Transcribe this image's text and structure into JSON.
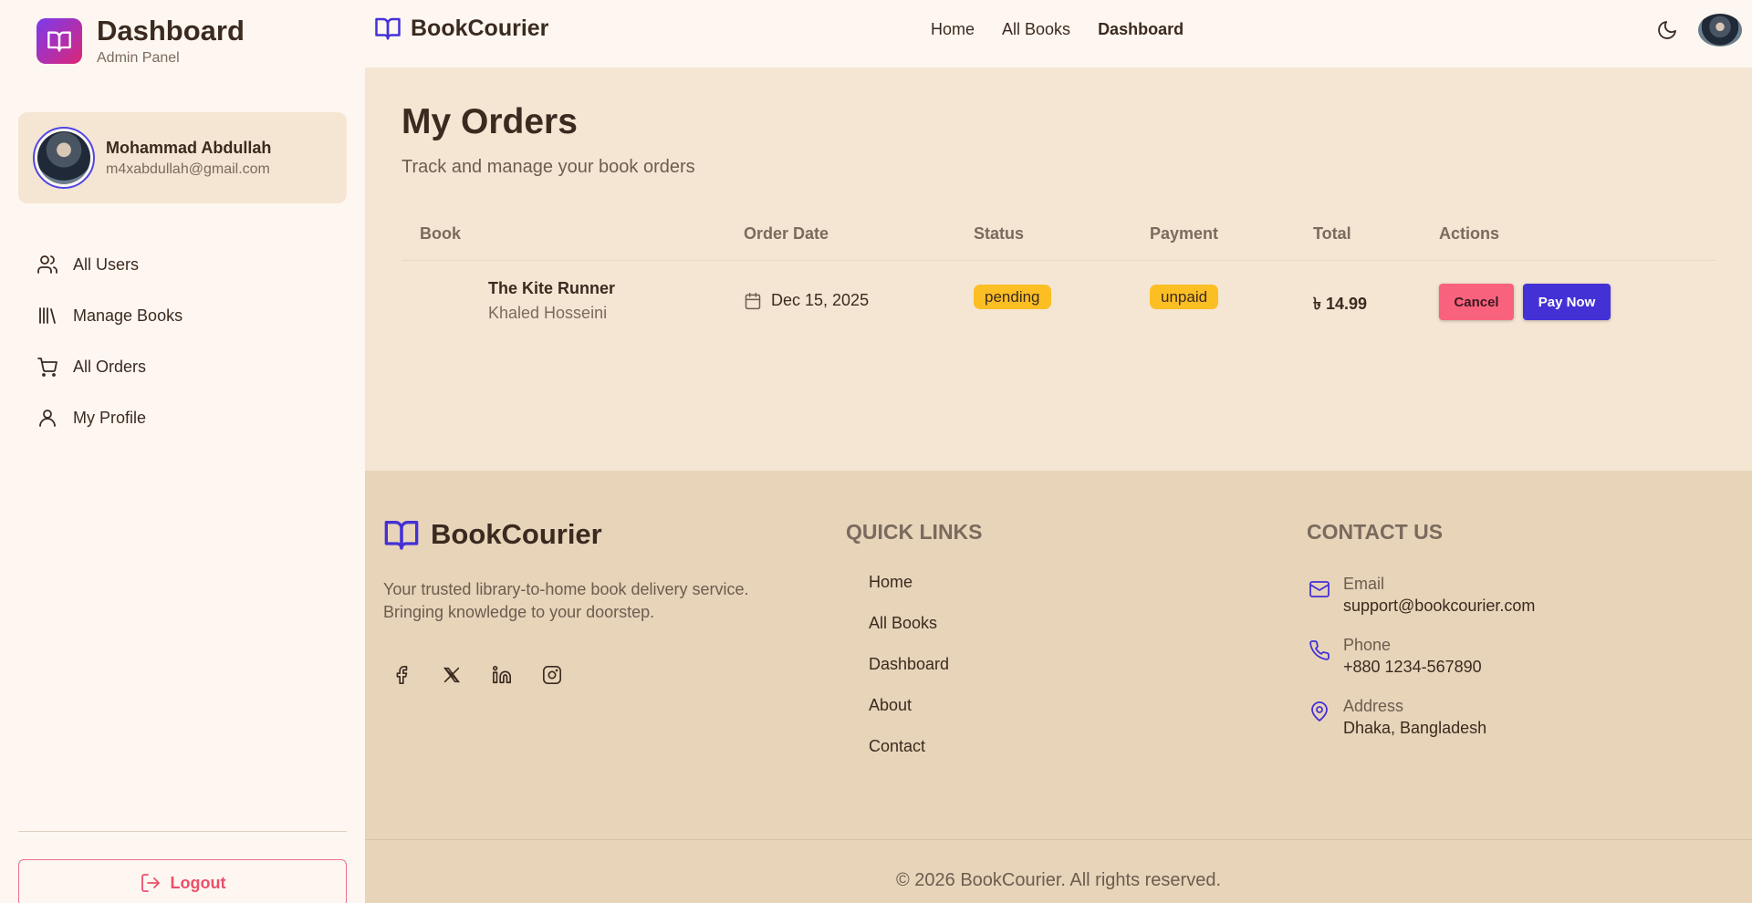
{
  "sidebar": {
    "brand_title": "Dashboard",
    "brand_sub": "Admin Panel",
    "user": {
      "name": "Mohammad Abdullah",
      "email": "m4xabdullah@gmail.com"
    },
    "items": [
      {
        "label": "All Users",
        "icon": "users-icon"
      },
      {
        "label": "Manage Books",
        "icon": "library-icon"
      },
      {
        "label": "All Orders",
        "icon": "cart-icon"
      },
      {
        "label": "My Profile",
        "icon": "user-icon"
      }
    ],
    "logout_label": "Logout"
  },
  "topbar": {
    "brand": "BookCourier",
    "links": [
      "Home",
      "All Books",
      "Dashboard"
    ],
    "active_link": "Dashboard"
  },
  "main": {
    "title": "My Orders",
    "subtitle": "Track and manage your book orders",
    "columns": [
      "Book",
      "Order Date",
      "Status",
      "Payment",
      "Total",
      "Actions"
    ],
    "rows": [
      {
        "book_title": "The Kite Runner",
        "book_author": "Khaled Hosseini",
        "order_date": "Dec 15, 2025",
        "status": "pending",
        "payment": "unpaid",
        "total": "৳ 14.99",
        "cancel_label": "Cancel",
        "pay_label": "Pay Now"
      }
    ]
  },
  "footer": {
    "brand": "BookCourier",
    "description": "Your trusted library-to-home book delivery service. Bringing knowledge to your doorstep.",
    "quick_links_heading": "QUICK LINKS",
    "quick_links": [
      "Home",
      "All Books",
      "Dashboard",
      "About",
      "Contact"
    ],
    "contact_heading": "CONTACT US",
    "contact": [
      {
        "label": "Email",
        "value": "support@bookcourier.com",
        "icon": "mail-icon"
      },
      {
        "label": "Phone",
        "value": "+880 1234-567890",
        "icon": "phone-icon"
      },
      {
        "label": "Address",
        "value": "Dhaka, Bangladesh",
        "icon": "map-pin-icon"
      }
    ],
    "copyright": "© 2026 BookCourier. All rights reserved."
  },
  "colors": {
    "accent": "#4431d6",
    "badge": "#fbbf24",
    "danger": "#f9627d",
    "background": "#f5e6d3"
  }
}
